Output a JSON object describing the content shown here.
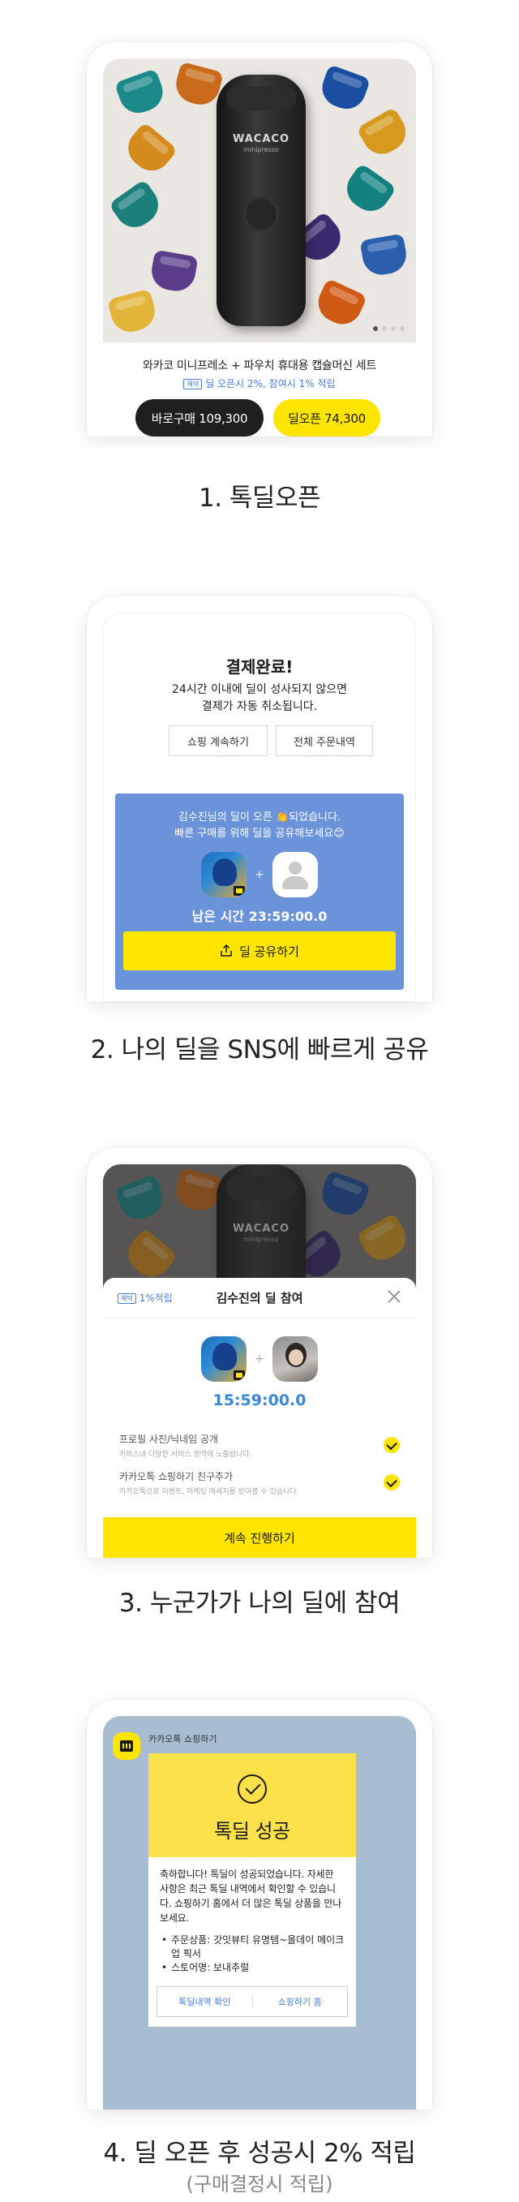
{
  "step1": {
    "caption": "1. 톡딜오픈",
    "machine_brand": "WACACO",
    "machine_model": "minipresso",
    "product_title": "와카코 미니프레소 + 파우치 휴대용 캡슐머신 세트",
    "badge": "혜택",
    "benefit": "딜 오픈시 2%, 참여시 1% 적립",
    "buy_now": "바로구매 109,300",
    "deal_open": "딜오픈 74,300"
  },
  "step2": {
    "caption": "2. 나의 딜을 SNS에 빠르게 공유",
    "done_title": "결제완료!",
    "done_line1": "24시간 이내에 딜이 성사되지 않으면",
    "done_line2": "결제가 자동 취소됩니다.",
    "continue_shopping": "쇼핑 계속하기",
    "all_orders": "전체 주문내역",
    "share_line1": "김수진님의 딜이 오픈 👏되었습니다.",
    "share_line2": "빠른 구매를 위해 딜을 공유해보세요😊",
    "remaining": "남은 시간 23:59:00.0",
    "share_button": "딜 공유하기"
  },
  "step3": {
    "caption": "3. 누군가가 나의 딜에 참여",
    "badge": "혜택",
    "reward": "1%적립",
    "sheet_title": "김수진의 딜 참여",
    "timer": "15:59:00.0",
    "cond1_title": "프로필 사진/닉네임 공개",
    "cond1_desc": "커머스내 다양한 서비스 영역에 노출됩니다.",
    "cond2_title": "카카오톡 쇼핑하기 친구추가",
    "cond2_desc": "카카오톡으로 이벤트, 마케팅 메세지를 받아볼 수 있습니다.",
    "continue": "계속 진행하기"
  },
  "step4": {
    "caption": "4. 딜 오픈 후 성공시 2% 적립",
    "sub": "(구매결정시 적립)",
    "sender": "카카오톡 쇼핑하기",
    "headline": "톡딜 성공",
    "body": "축하합니다! 톡딜이 성공되었습니다. 자세한 사항은 최근 톡딜 내역에서 확인할 수 있습니다. 쇼핑하기 홈에서 더 많은 톡딜 상품을 만나보세요.",
    "items": [
      "주문상품: 갓잇뷰티 유명템~올데이 메이크업 픽서",
      "스토어명: 보내추럴"
    ],
    "btn_history": "톡딜내역 확인",
    "btn_home": "쇼핑하기 홈"
  }
}
